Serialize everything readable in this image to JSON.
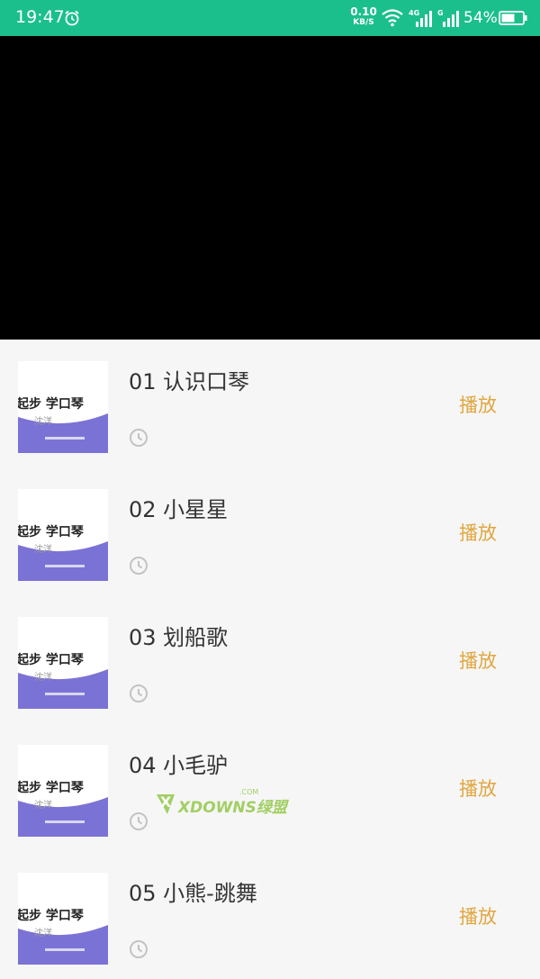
{
  "status_bar": {
    "time": "19:47",
    "net_speed_value": "0.10",
    "net_speed_unit": "KB/S",
    "battery": "54%",
    "network_label_1": "4G",
    "network_label_2": "G"
  },
  "list": {
    "play_label": "播放",
    "thumb_text": "起步 学口琴",
    "thumb_sub": "沈洋",
    "items": [
      {
        "title": "01 认识口琴"
      },
      {
        "title": "02 小星星"
      },
      {
        "title": "03 划船歌"
      },
      {
        "title": "04 小毛驴"
      },
      {
        "title": "05 小熊-跳舞"
      }
    ]
  },
  "watermark": {
    "text": "XDOWNS绿盟",
    "small": ".COM"
  },
  "colors": {
    "status_bar": "#1bbf8c",
    "play": "#e1a63f",
    "thumb_wave": "#7b72d6"
  }
}
